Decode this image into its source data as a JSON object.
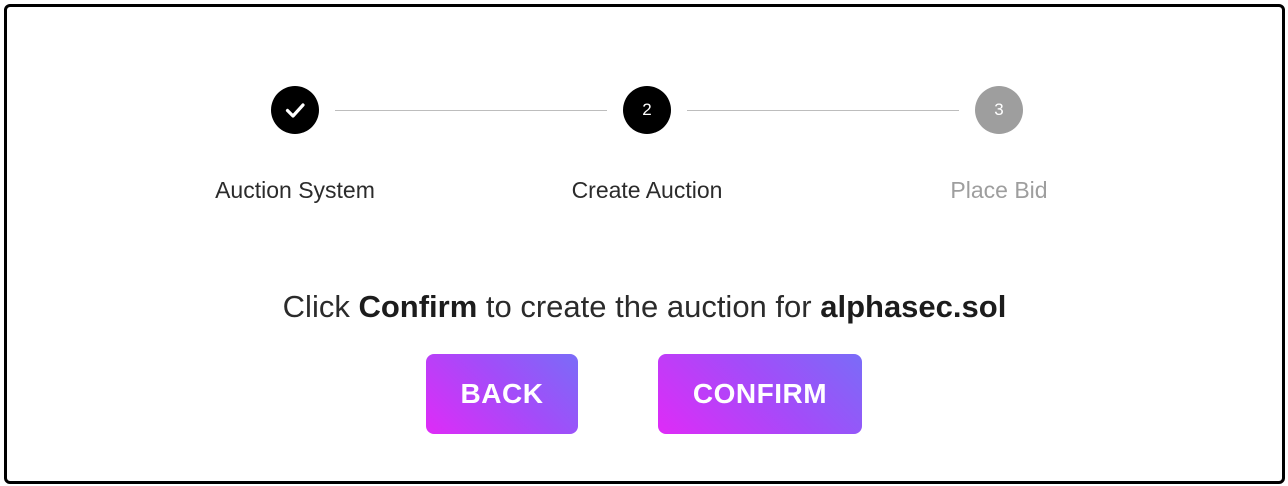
{
  "stepper": {
    "steps": [
      {
        "label": "Auction System",
        "state": "completed",
        "number": ""
      },
      {
        "label": "Create Auction",
        "state": "active",
        "number": "2"
      },
      {
        "label": "Place Bid",
        "state": "pending",
        "number": "3"
      }
    ]
  },
  "message": {
    "prefix": "Click ",
    "emphasis_action": "Confirm",
    "middle": " to create the auction for ",
    "domain_name": "alphasec.sol"
  },
  "actions": {
    "back_label": "BACK",
    "confirm_label": "CONFIRM"
  },
  "colors": {
    "completed_step": "#000000",
    "active_step": "#000000",
    "pending_step": "#9e9e9e",
    "button_gradient_start": "#df2bf7",
    "button_gradient_end": "#7a6cf8"
  },
  "icons": {
    "completed_step_icon": "checkmark-icon"
  }
}
